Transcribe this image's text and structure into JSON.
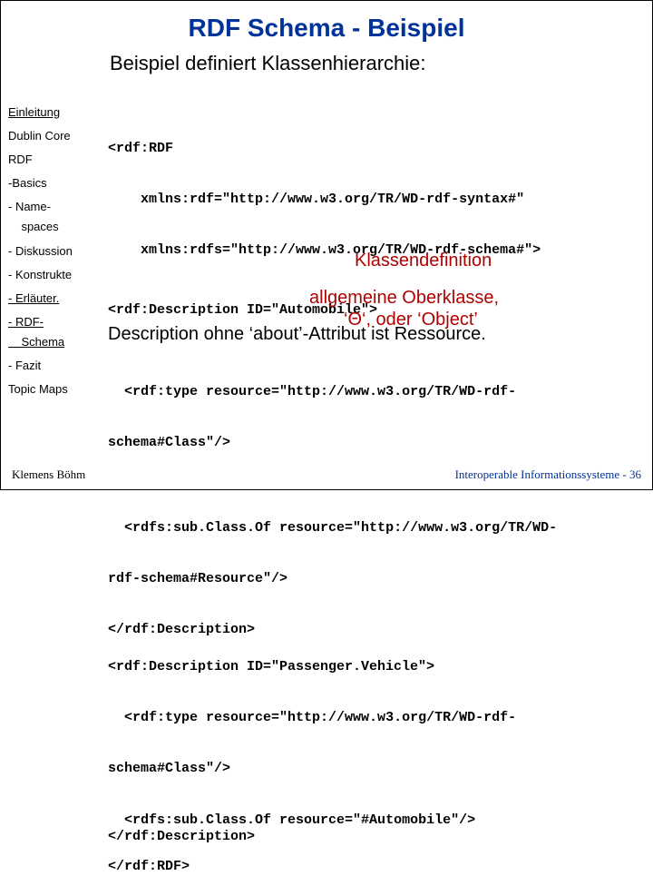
{
  "title": "RDF Schema - Beispiel",
  "subtitle": "Beispiel definiert Klassenhierarchie:",
  "sidebar": {
    "items": [
      {
        "label": "Einleitung",
        "underlined": true
      },
      {
        "label": "Dublin Core",
        "underlined": false
      },
      {
        "label": "RDF",
        "underlined": false
      },
      {
        "label": "-Basics",
        "underlined": false
      },
      {
        "label": "- Name-\n    spaces",
        "underlined": false
      },
      {
        "label": "- Diskussion",
        "underlined": false
      },
      {
        "label": "- Konstrukte",
        "underlined": false
      },
      {
        "label": "- Erläuter.",
        "underlined": true
      },
      {
        "label": "- RDF-\n    Schema",
        "underlined": true
      },
      {
        "label": "- Fazit",
        "underlined": false
      },
      {
        "label": "Topic Maps",
        "underlined": false
      }
    ]
  },
  "code": {
    "open1": "<rdf:RDF",
    "open2": "    xmlns:rdf=\"http://www.w3.org/TR/WD-rdf-syntax#\"",
    "open3": "    xmlns:rdfs=\"http://www.w3.org/TR/WD-rdf-schema#\">",
    "desc1": "<rdf:Description ID=\"Automobile\">",
    "prose1": "Description ohne ‘about’-Attribut ist Ressource.",
    "type1a": "  <rdf:type resource=\"http://www.w3.org/TR/WD-rdf-",
    "type1b": "schema#Class\"/>",
    "sub1a": "  <rdfs:sub.Class.Of resource=\"http://www.w3.org/TR/WD-",
    "sub1b": "rdf-schema#Resource\"/>",
    "close1": "</rdf:Description>",
    "desc2": "<rdf:Description ID=\"Passenger.Vehicle\">",
    "type2a": "  <rdf:type resource=\"http://www.w3.org/TR/WD-rdf-",
    "type2b": "schema#Class\"/>",
    "sub2": "  <rdfs:sub.Class.Of resource=\"#Automobile\"/>",
    "close2": "</rdf:Description>",
    "end": "</rdf:RDF>"
  },
  "annotations": {
    "klass": "Klassendefinition",
    "ober1": "allgemeine Oberklasse,",
    "ober2": "‘Θ‘, oder ‘Object’"
  },
  "footer": {
    "left": "Klemens Böhm",
    "right": "Interoperable Informationssysteme - 36"
  }
}
